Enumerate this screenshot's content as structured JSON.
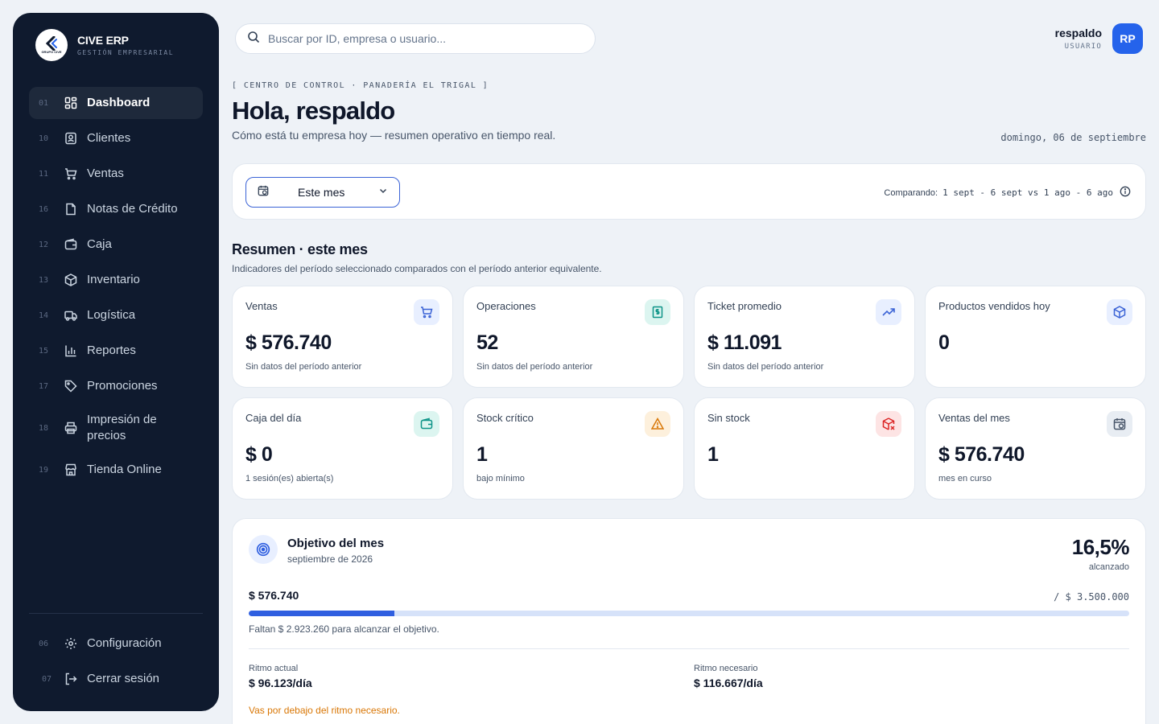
{
  "brand": {
    "name": "CIVE ERP",
    "subtitle": "GESTIÓN EMPRESARIAL",
    "logo_text": "GRUPO CIVE"
  },
  "sidebar": {
    "items": [
      {
        "num": "01",
        "label": "Dashboard",
        "icon": "dashboard-icon"
      },
      {
        "num": "10",
        "label": "Clientes",
        "icon": "contacts-icon"
      },
      {
        "num": "11",
        "label": "Ventas",
        "icon": "cart-icon"
      },
      {
        "num": "16",
        "label": "Notas de Crédito",
        "icon": "document-icon"
      },
      {
        "num": "12",
        "label": "Caja",
        "icon": "wallet-icon"
      },
      {
        "num": "13",
        "label": "Inventario",
        "icon": "package-icon"
      },
      {
        "num": "14",
        "label": "Logística",
        "icon": "truck-icon"
      },
      {
        "num": "15",
        "label": "Reportes",
        "icon": "bar-chart-icon"
      },
      {
        "num": "17",
        "label": "Promociones",
        "icon": "tag-icon"
      },
      {
        "num": "18",
        "label": "Impresión de precios",
        "icon": "printer-icon"
      },
      {
        "num": "19",
        "label": "Tienda Online",
        "icon": "store-icon"
      }
    ],
    "bottom": [
      {
        "num": "06",
        "label": "Configuración",
        "icon": "gear-icon"
      },
      {
        "num": "07",
        "label": "Cerrar sesión",
        "icon": "logout-icon"
      }
    ]
  },
  "search": {
    "placeholder": "Buscar por ID, empresa o usuario..."
  },
  "user": {
    "name": "respaldo",
    "role": "USUARIO",
    "initials": "RP"
  },
  "header": {
    "crumb": "[ CENTRO DE CONTROL · PANADERÍA EL TRIGAL ]",
    "title": "Hola, respaldo",
    "subtitle": "Cómo está tu empresa hoy — resumen operativo en tiempo real.",
    "date": "domingo, 06 de septiembre"
  },
  "filter": {
    "period": "Este mes",
    "compare_label": "Comparando:",
    "compare_range": "1 sept - 6 sept vs 1 ago - 6 ago"
  },
  "summary": {
    "title": "Resumen · este mes",
    "subtitle": "Indicadores del período seleccionado comparados con el período anterior equivalente."
  },
  "kpis": [
    {
      "label": "Ventas",
      "value": "$ 576.740",
      "note": "Sin datos del período anterior",
      "icon": "cart-icon",
      "color": "#3b63d6",
      "bg": "#e8efff"
    },
    {
      "label": "Operaciones",
      "value": "52",
      "note": "Sin datos del período anterior",
      "icon": "receipt-icon",
      "color": "#0d9488",
      "bg": "#dcf5f0"
    },
    {
      "label": "Ticket promedio",
      "value": "$ 11.091",
      "note": "Sin datos del período anterior",
      "icon": "trending-up-icon",
      "color": "#3b63d6",
      "bg": "#e8efff"
    },
    {
      "label": "Productos vendidos hoy",
      "value": "0",
      "note": "",
      "icon": "package-icon",
      "color": "#3b63d6",
      "bg": "#e8efff"
    },
    {
      "label": "Caja del día",
      "value": "$ 0",
      "note": "1 sesión(es) abierta(s)",
      "icon": "wallet-icon",
      "color": "#0d9488",
      "bg": "#dcf5f0"
    },
    {
      "label": "Stock crítico",
      "value": "1",
      "note": "bajo mínimo",
      "icon": "alert-icon",
      "color": "#d97706",
      "bg": "#fdf0dc"
    },
    {
      "label": "Sin stock",
      "value": "1",
      "note": "",
      "icon": "package-x-icon",
      "color": "#dc2626",
      "bg": "#fde4e4"
    },
    {
      "label": "Ventas del mes",
      "value": "$ 576.740",
      "note": "mes en curso",
      "icon": "calendar-clock-icon",
      "color": "#475569",
      "bg": "#e8edf3"
    }
  ],
  "goal": {
    "title": "Objetivo del mes",
    "period": "septiembre de 2026",
    "percent": "16,5%",
    "percent_label": "alcanzado",
    "progress": 0.165,
    "current": "$ 576.740",
    "target": "/ $ 3.500.000",
    "missing": "Faltan $ 2.923.260 para alcanzar el objetivo.",
    "rate_actual_label": "Ritmo actual",
    "rate_actual": "$ 96.123/día",
    "rate_needed_label": "Ritmo necesario",
    "rate_needed": "$ 116.667/día",
    "warning": "Vas por debajo del ritmo necesario."
  },
  "colors": {
    "sidebar_bg": "#0f1a2e",
    "accent": "#2563eb",
    "warning": "#d97706"
  }
}
